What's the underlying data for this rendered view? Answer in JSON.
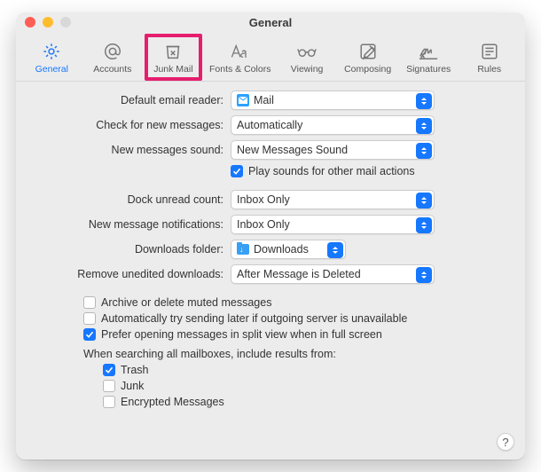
{
  "window": {
    "title": "General"
  },
  "toolbar": {
    "items": [
      {
        "label": "General"
      },
      {
        "label": "Accounts"
      },
      {
        "label": "Junk Mail"
      },
      {
        "label": "Fonts & Colors"
      },
      {
        "label": "Viewing"
      },
      {
        "label": "Composing"
      },
      {
        "label": "Signatures"
      },
      {
        "label": "Rules"
      }
    ]
  },
  "labels": {
    "default_reader": "Default email reader:",
    "check_messages": "Check for new messages:",
    "new_sound": "New messages sound:",
    "play_sounds": "Play sounds for other mail actions",
    "dock_unread": "Dock unread count:",
    "new_notifications": "New message notifications:",
    "downloads_folder": "Downloads folder:",
    "remove_downloads": "Remove unedited downloads:",
    "archive_muted": "Archive or delete muted messages",
    "auto_retry": "Automatically try sending later if outgoing server is unavailable",
    "split_view": "Prefer opening messages in split view when in full screen",
    "search_header": "When searching all mailboxes, include results from:",
    "trash": "Trash",
    "junk": "Junk",
    "encrypted": "Encrypted Messages"
  },
  "values": {
    "default_reader": "Mail",
    "check_messages": "Automatically",
    "new_sound": "New Messages Sound",
    "dock_unread": "Inbox Only",
    "new_notifications": "Inbox Only",
    "downloads_folder": "Downloads",
    "remove_downloads": "After Message is Deleted"
  },
  "checks": {
    "play_sounds": true,
    "archive_muted": false,
    "auto_retry": false,
    "split_view": true,
    "trash": true,
    "junk": false,
    "encrypted": false
  },
  "help": "?"
}
